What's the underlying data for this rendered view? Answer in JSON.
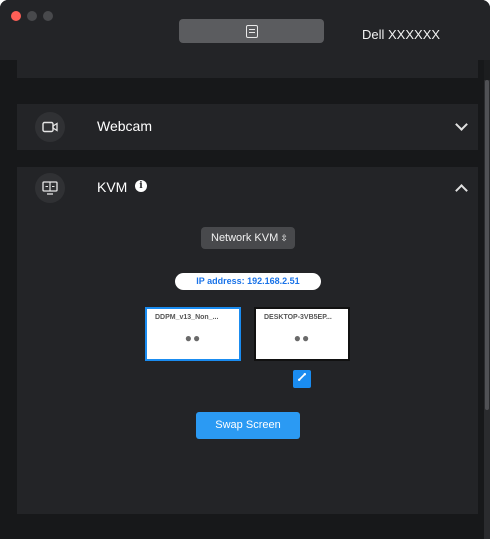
{
  "window": {
    "monitor_name": "Dell XXXXXX",
    "top_button_icon": "document-icon"
  },
  "sections": {
    "webcam": {
      "title": "Webcam",
      "icon": "webcam-icon",
      "expanded": false
    },
    "kvm": {
      "title": "KVM",
      "icon": "kvm-icon",
      "info_icon": "i",
      "expanded": true,
      "mode_select": {
        "value": "Network KVM",
        "arrows": "⌃⌄"
      },
      "ip_label": "IP address: 192.168.2.51",
      "screens": [
        {
          "name": "DDPM_v13_Non_...",
          "dots": "●●",
          "active": true
        },
        {
          "name": "DESKTOP-3VB5EP...",
          "dots": "●●",
          "active": false
        }
      ],
      "link_icon": "✎",
      "swap_label": "Swap Screen"
    }
  },
  "colors": {
    "accent": "#2b9af3",
    "window_bg": "#17181a",
    "panel_bg": "#232427"
  }
}
